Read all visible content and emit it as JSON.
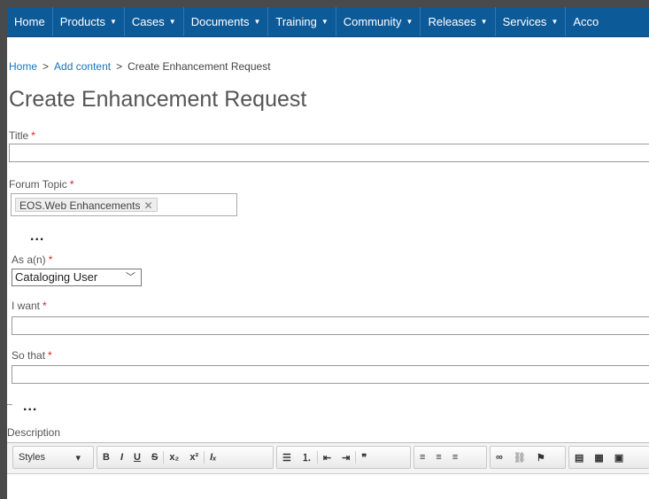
{
  "nav": {
    "items": [
      {
        "label": "Home",
        "caret": ""
      },
      {
        "label": "Products",
        "caret": "▼"
      },
      {
        "label": "Cases",
        "caret": "▼"
      },
      {
        "label": "Documents",
        "caret": "▼"
      },
      {
        "label": "Training",
        "caret": "▼"
      },
      {
        "label": "Community",
        "caret": "▼"
      },
      {
        "label": "Releases",
        "caret": "▼"
      },
      {
        "label": "Services",
        "caret": "▼"
      },
      {
        "label": "Acco",
        "caret": ""
      }
    ]
  },
  "breadcrumb": {
    "home": "Home",
    "separator": ">",
    "add_content": "Add content",
    "current": "Create Enhancement Request"
  },
  "page_title": "Create Enhancement Request",
  "form": {
    "required_mark": "*",
    "title_label": "Title",
    "forum_topic_label": "Forum Topic",
    "forum_topic_tag": "EOS.Web Enhancements",
    "tag_remove": "✕",
    "ellipsis": "...",
    "as_a_label": "As a(n)",
    "as_a_value": "Cataloging User",
    "as_a_chevron": "﹀",
    "i_want_label": "I want",
    "so_that_label": "So that",
    "description_label": "Description"
  },
  "toolbar": {
    "styles_label": "Styles",
    "styles_arrow": "▾",
    "bold": "B",
    "italic": "I",
    "underline": "U",
    "strike": "S",
    "subscript": "x₂",
    "superscript": "x²",
    "remove_format": "Iₓ",
    "bullet_list": "☰",
    "numbered_list": "⒈",
    "outdent": "⇤",
    "indent": "⇥",
    "blockquote": "❞",
    "align_left": "≡",
    "align_center": "≡",
    "align_right": "≡",
    "link": "∞",
    "unlink": "⛓",
    "anchor": "⚑",
    "horizontal_rule": "▤",
    "table": "▦",
    "image": "▣"
  },
  "colors": {
    "nav_bg": "#0d5a99",
    "link": "#1a74b8",
    "required": "#dd2222"
  }
}
